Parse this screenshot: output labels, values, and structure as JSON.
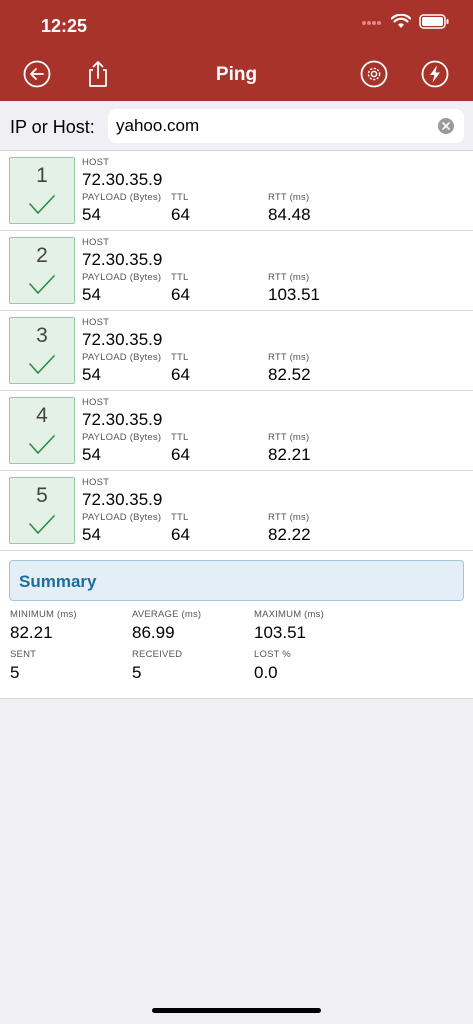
{
  "status": {
    "time": "12:25"
  },
  "nav": {
    "title": "Ping"
  },
  "search": {
    "label": "IP or Host:",
    "value": "yahoo.com"
  },
  "labels": {
    "host": "HOST",
    "payload": "PAYLOAD (Bytes)",
    "ttl": "TTL",
    "rtt": "RTT (ms)"
  },
  "results": [
    {
      "seq": "1",
      "host": "72.30.35.9",
      "payload": "54",
      "ttl": "64",
      "rtt": "84.48"
    },
    {
      "seq": "2",
      "host": "72.30.35.9",
      "payload": "54",
      "ttl": "64",
      "rtt": "103.51"
    },
    {
      "seq": "3",
      "host": "72.30.35.9",
      "payload": "54",
      "ttl": "64",
      "rtt": "82.52"
    },
    {
      "seq": "4",
      "host": "72.30.35.9",
      "payload": "54",
      "ttl": "64",
      "rtt": "82.21"
    },
    {
      "seq": "5",
      "host": "72.30.35.9",
      "payload": "54",
      "ttl": "64",
      "rtt": "82.22"
    }
  ],
  "summary": {
    "title": "Summary",
    "minimum_label": "MINIMUM (ms)",
    "minimum": "82.21",
    "average_label": "AVERAGE (ms)",
    "average": "86.99",
    "maximum_label": "MAXIMUM (ms)",
    "maximum": "103.51",
    "sent_label": "SENT",
    "sent": "5",
    "received_label": "RECEIVED",
    "received": "5",
    "lost_label": "LOST %",
    "lost": "0.0"
  },
  "icons": {
    "back": "back-arrow-icon",
    "share": "share-icon",
    "settings": "gear-icon",
    "quick": "lightning-icon",
    "clear": "clear-icon",
    "check": "checkmark-icon"
  },
  "colors": {
    "header": "#a8332a",
    "success_bg": "#e3f1e6",
    "success_border": "#9bc7a5",
    "check": "#2f8a43",
    "summary_title": "#1d6e9e"
  }
}
